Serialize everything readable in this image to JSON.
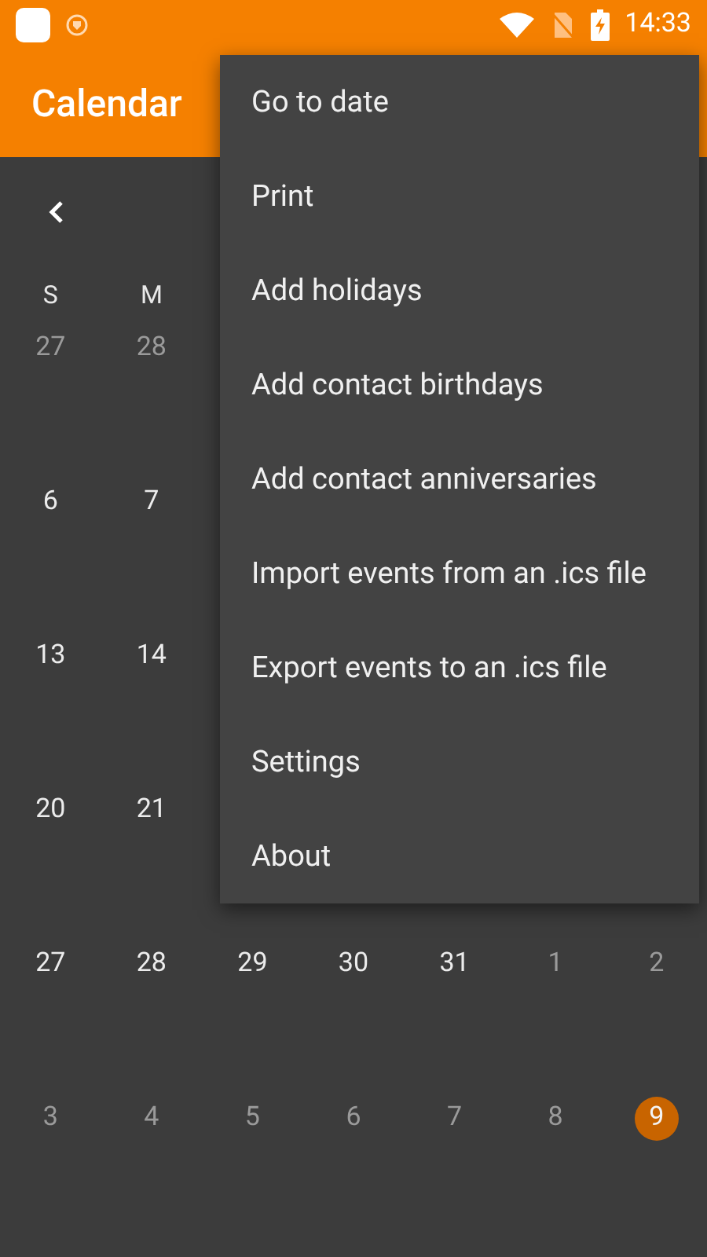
{
  "status_bar": {
    "time": "14:33"
  },
  "app_bar": {
    "title": "Calendar"
  },
  "weekdays": [
    "S",
    "M"
  ],
  "weeks": [
    [
      {
        "day": "27",
        "dim": true
      },
      {
        "day": "28",
        "dim": true
      }
    ],
    [
      {
        "day": "6",
        "dim": false
      },
      {
        "day": "7",
        "dim": false
      }
    ],
    [
      {
        "day": "13",
        "dim": false
      },
      {
        "day": "14",
        "dim": false
      }
    ],
    [
      {
        "day": "20",
        "dim": false
      },
      {
        "day": "21",
        "dim": false
      }
    ],
    [
      {
        "day": "27",
        "dim": false
      },
      {
        "day": "28",
        "dim": false
      },
      {
        "day": "29",
        "dim": false
      },
      {
        "day": "30",
        "dim": false
      },
      {
        "day": "31",
        "dim": false
      },
      {
        "day": "1",
        "dim": true
      },
      {
        "day": "2",
        "dim": true
      }
    ],
    [
      {
        "day": "3",
        "dim": true
      },
      {
        "day": "4",
        "dim": true
      },
      {
        "day": "5",
        "dim": true
      },
      {
        "day": "6",
        "dim": true
      },
      {
        "day": "7",
        "dim": true
      },
      {
        "day": "8",
        "dim": true
      },
      {
        "day": "9",
        "dim": true,
        "today": true
      }
    ]
  ],
  "menu": [
    "Go to date",
    "Print",
    "Add holidays",
    "Add contact birthdays",
    "Add contact anniversaries",
    "Import events from an .ics file",
    "Export events to an .ics file",
    "Settings",
    "About"
  ]
}
